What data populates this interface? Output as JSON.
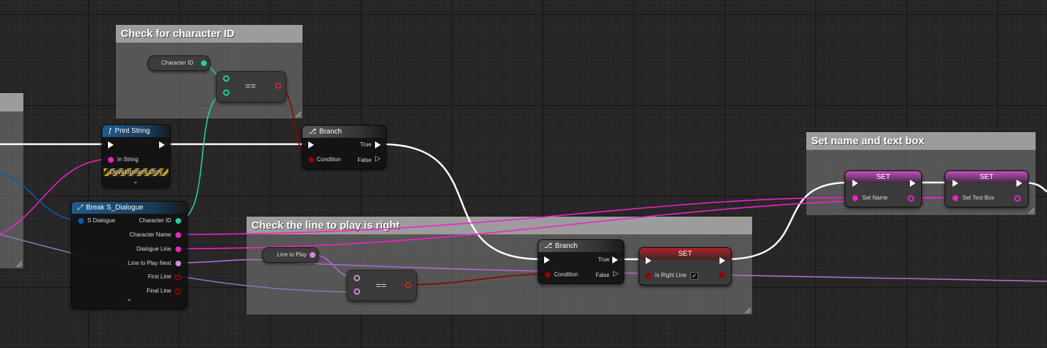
{
  "comments": {
    "check_char": {
      "title": "Check for character ID"
    },
    "check_line": {
      "title": "Check the line to play is right"
    },
    "set_name": {
      "title": "Set name and text box"
    }
  },
  "nodes": {
    "print_string": {
      "title": "Print String",
      "in_string": "In String",
      "dev_only": "Development Only"
    },
    "break": {
      "title": "Break S_Dialogue",
      "in": "S Dialogue",
      "outs": [
        "Character ID",
        "Character Name",
        "Dialogue Line",
        "Line to Play Next",
        "First Line",
        "Final Line"
      ]
    },
    "branch1": {
      "title": "Branch",
      "condition": "Condition",
      "true": "True",
      "false": "False"
    },
    "branch2": {
      "title": "Branch",
      "condition": "Condition",
      "true": "True",
      "false": "False"
    },
    "eq1": {
      "op": "=="
    },
    "eq2": {
      "op": "=="
    },
    "set_right": {
      "title": "SET",
      "field": "Is Right Line",
      "checked": "✓"
    },
    "set_name": {
      "title": "SET",
      "field": "Set Name"
    },
    "set_text": {
      "title": "SET",
      "field": "Set Text Box"
    },
    "var_char_id": {
      "label": "Character ID"
    },
    "var_line": {
      "label": "Line to Play"
    }
  },
  "colors": {
    "exec": "#ffffff",
    "int": "#1dd3a0",
    "string": "#f022c8",
    "bool": "#950000",
    "struct": "#0a5ab7",
    "integer_pink": "#d38ad6"
  }
}
